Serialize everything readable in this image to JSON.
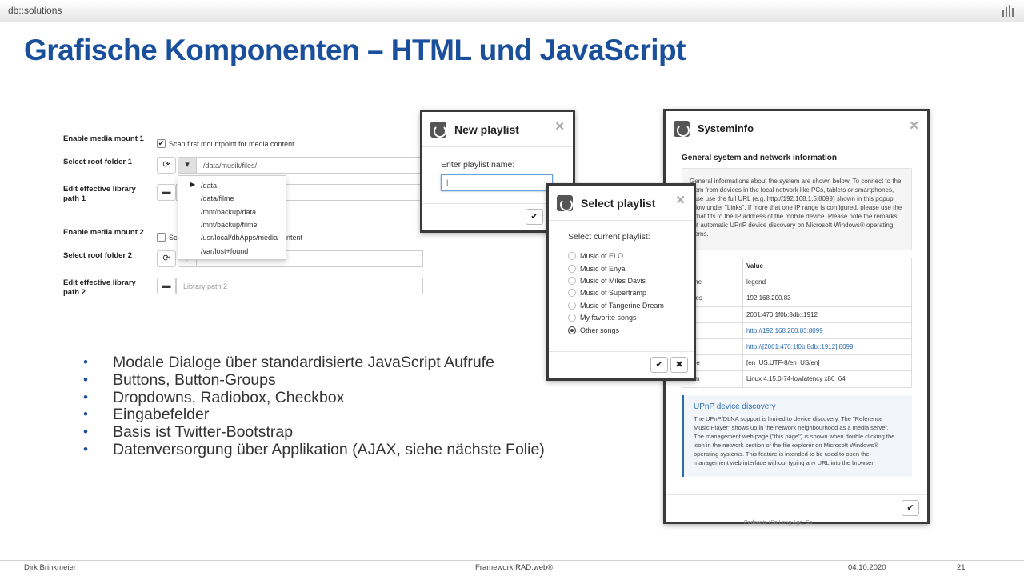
{
  "header": {
    "brand": "db::solutions",
    "title": "Grafische Komponenten – HTML und JavaScript"
  },
  "settings": {
    "mount1_label": "Enable media mount 1",
    "mount1_checkbox": "Scan first mountpoint for media content",
    "root1_label": "Select root folder 1",
    "root1_value": "/data/musik/files/",
    "lib1_label_a": "Edit effective library",
    "lib1_label_b": "path 1",
    "mount2_label": "Enable media mount 2",
    "mount2_checkbox_a": "Sca",
    "mount2_checkbox_b": "ontent",
    "root2_label": "Select root folder 2",
    "lib2_label_a": "Edit effective library",
    "lib2_label_b": "path 2",
    "lib2_placeholder": "Library path 2",
    "dropdown_items": [
      "/data",
      "/data/filme",
      "/mnt/backup/data",
      "/mnt/backup/filme",
      "/usr/local/dbApps/media",
      "/var/lost+found"
    ]
  },
  "bullets": [
    "Modale Dialoge über standardisierte JavaScript Aufrufe",
    "Buttons, Button-Groups",
    "Dropdowns, Radiobox, Checkbox",
    "Eingabefelder",
    "Basis ist Twitter-Bootstrap",
    "Datenversorgung über Applikation (AJAX, siehe nächste Folie)"
  ],
  "new_playlist": {
    "title": "New playlist",
    "label": "Enter playlist name:",
    "value": "|"
  },
  "select_playlist": {
    "title": "Select playlist",
    "label": "Select current playlist:",
    "options": [
      "Music of ELO",
      "Music of Enya",
      "Music of Miles Davis",
      "Music of Supertramp",
      "Music of Tangerine Dream",
      "My favorite songs",
      "Other songs"
    ],
    "selected": "Other songs"
  },
  "systeminfo": {
    "title": "Systeminfo",
    "heading": "General system and network information",
    "intro_1": "General informations about the system are shown below. To connect to the",
    "intro_2": "stem from devices in the local network like PCs, tablets or smartphones,",
    "intro_3": "ease use the full URL (e.g. http://192.168.1.5:8099) shown in this popup",
    "intro_4": "ndow under \"Links\". If more that one IP range is configured, please use the",
    "intro_5": "e that fits to the IP address of the mobile device. Please note the remarks",
    "intro_6": "out automatic UPnP device discovery on Microsoft Windows® operating",
    "intro_7": "stems.",
    "col_key": "e",
    "col_value": "Value",
    "rows": [
      {
        "k": "name",
        "v": "legend"
      },
      {
        "k": "esses",
        "v": "192.168.200.83"
      },
      {
        "k": "",
        "v": "2001:470:1f0b:8db::1912"
      },
      {
        "k": "",
        "v": "http://192.168.200.83:8099"
      },
      {
        "k": "",
        "v": "http://[2001:470:1f0b:8db::1912]:8099"
      },
      {
        "k": "uage",
        "v": "[en_US.UTF-8/en_US/en]"
      },
      {
        "k": "stem",
        "v": "Linux 4.15.0-74-lowlatency x86_64"
      }
    ],
    "callout_title": "UPnP device discovery",
    "callout_1": "The UPnP/DLNA support is limited to device discovery. The \"Reference",
    "callout_2": "Music Player\" shows up in the network neighbourhood as a media server.",
    "callout_3": "The management web page (\"this page\") is shown when double clicking the",
    "callout_4": "icon in the network section of the file explorer on Microsoft Windows®",
    "callout_5": "operating systems. This feature is intended to be used to open the",
    "callout_6": "management web interface without typing any URL into the browser.",
    "behind_text": "Podcasts (So Long Ago, So"
  },
  "footer": {
    "author": "Dirk Brinkmeier",
    "framework": "Framework RAD.web®",
    "date": "04.10.2020",
    "page": "21"
  }
}
